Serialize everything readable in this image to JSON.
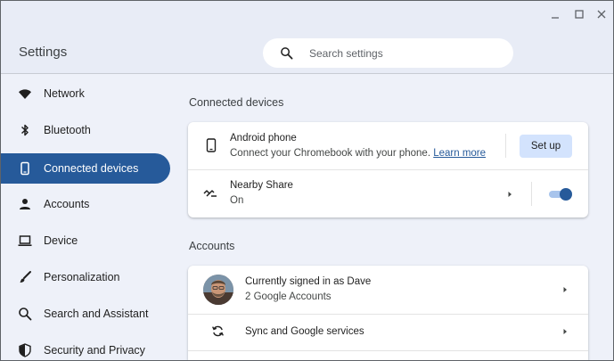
{
  "app": {
    "title": "Settings"
  },
  "search": {
    "placeholder": "Search settings",
    "value": "",
    "icon": "search-icon"
  },
  "sidebar": {
    "items": [
      {
        "label": "Network",
        "icon": "wifi-icon"
      },
      {
        "label": "Bluetooth",
        "icon": "bluetooth-icon"
      },
      {
        "label": "Connected devices",
        "icon": "phone-icon",
        "active": true
      },
      {
        "label": "Accounts",
        "icon": "person-icon"
      },
      {
        "label": "Device",
        "icon": "laptop-icon"
      },
      {
        "label": "Personalization",
        "icon": "brush-icon"
      },
      {
        "label": "Search and Assistant",
        "icon": "search-icon"
      },
      {
        "label": "Security and Privacy",
        "icon": "shield-icon"
      }
    ]
  },
  "connected": {
    "title": "Connected devices",
    "android": {
      "name": "Android phone",
      "desc": "Connect your Chromebook with your phone.",
      "link": "Learn more",
      "button": "Set up"
    },
    "nearby": {
      "name": "Nearby Share",
      "status": "On",
      "enabled": true
    }
  },
  "accounts": {
    "title": "Accounts",
    "signed_in": {
      "primary": "Currently signed in as Dave",
      "secondary": "2 Google Accounts"
    },
    "sync": {
      "label": "Sync and Google services"
    }
  },
  "colors": {
    "accent": "#265a9a",
    "accent_light": "#d3e3fd",
    "background": "#eef1f9"
  }
}
